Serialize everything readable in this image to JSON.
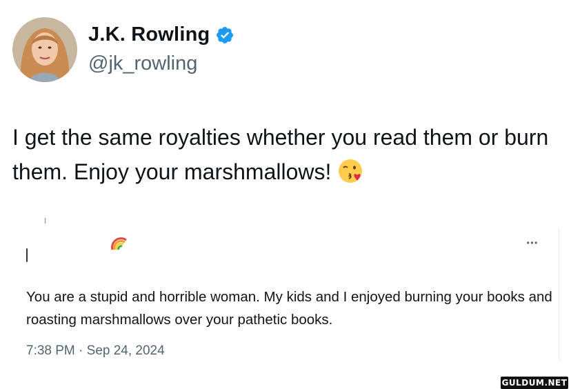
{
  "author": {
    "name": "J.K. Rowling",
    "handle": "@jk_rowling",
    "verified": true,
    "avatar_icon": "profile-photo"
  },
  "tweet": {
    "text": "I get the same royalties whether you read them or burn them. Enjoy your marshmallows!",
    "emoji_icon": "face-blowing-a-kiss"
  },
  "quoted": {
    "name_emoji_icon": "rainbow",
    "menu_label": "···",
    "text": "You are a stupid and horrible woman. My kids and I enjoyed burning your books and roasting marshmallows over your pathetic books.",
    "timestamp": "7:38 PM · Sep 24, 2024"
  },
  "watermark": "GULDUM.NET",
  "colors": {
    "verified": "#1d9bf0",
    "text": "#0f1419",
    "secondary": "#536471"
  }
}
